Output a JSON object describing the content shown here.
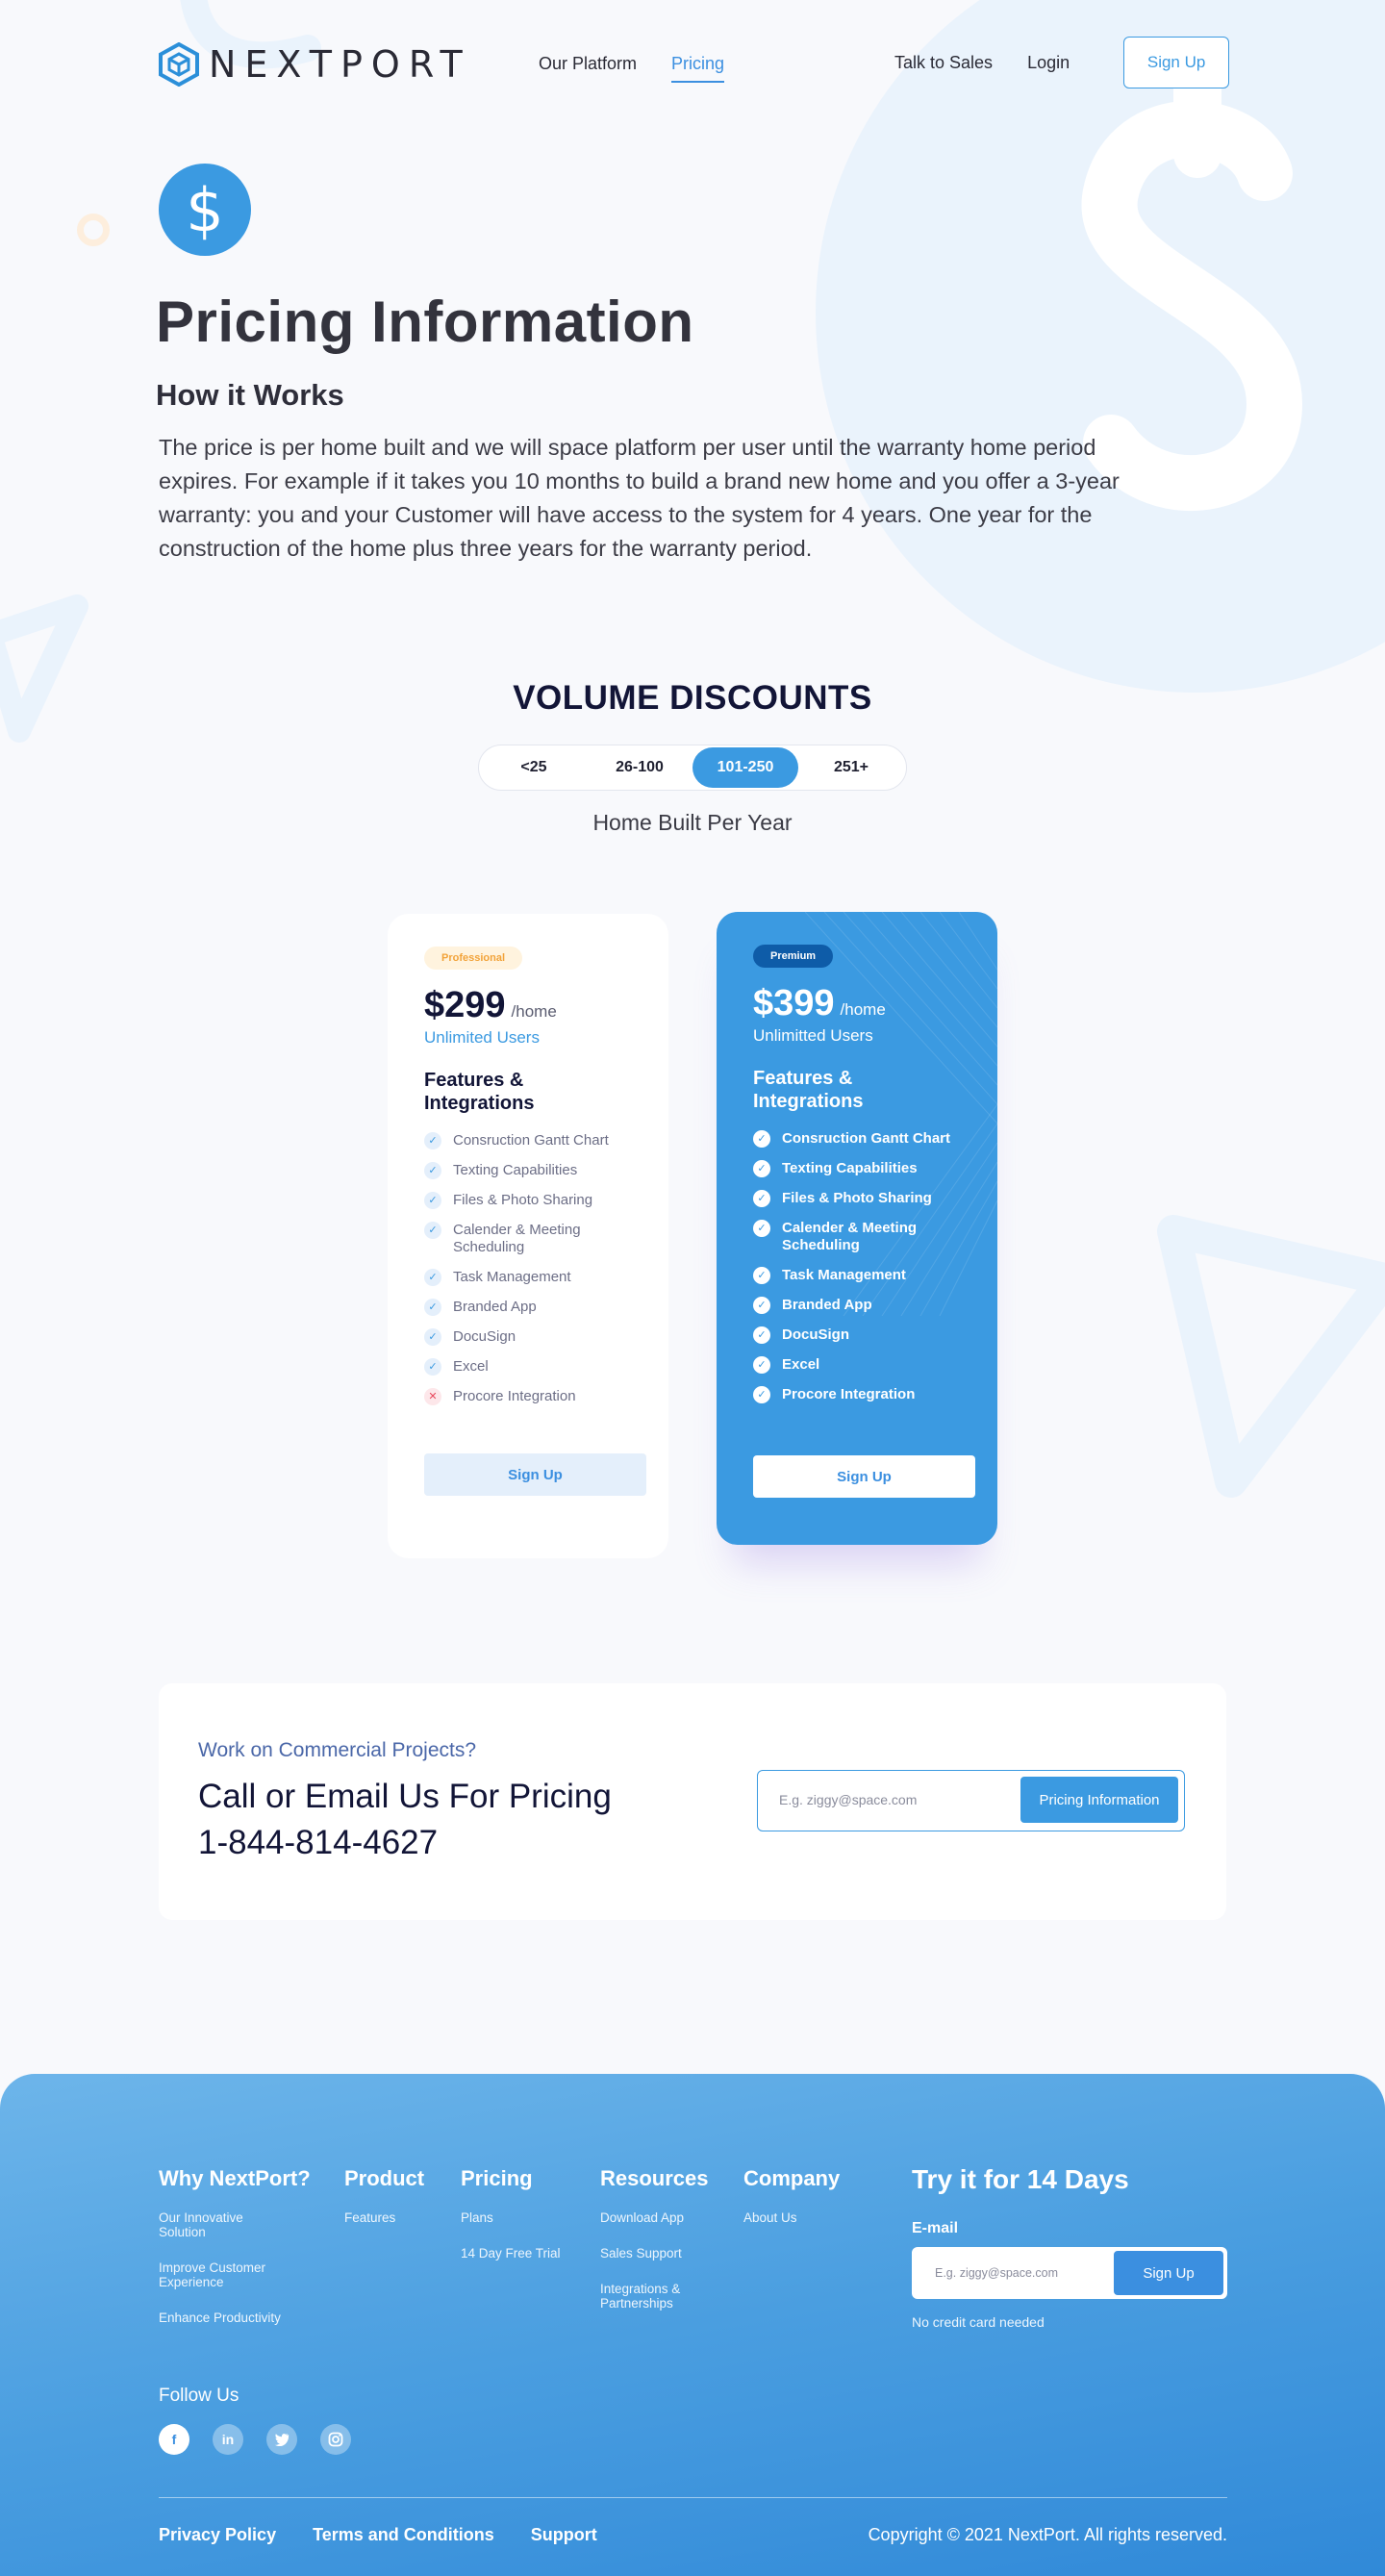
{
  "brand": {
    "name": "NEXTPORT",
    "accent": "#3b9ae1",
    "navy": "#121537"
  },
  "nav": {
    "items": [
      {
        "label": "Our Platform"
      },
      {
        "label": "Pricing"
      }
    ],
    "talk_to_sales": "Talk to Sales",
    "login": "Login",
    "signup": "Sign Up"
  },
  "hero": {
    "icon": "dollar-icon",
    "title": "Pricing Information",
    "subtitle": "How it Works",
    "body": "The price is per home built and we will space  platform per user until the warranty home period expires. For example if it takes you 10 months to build a brand new home and you offer a 3-year warranty:  you and your Customer will have access to the system  for 4 years. One year for the construction of the home plus three years for the warranty period."
  },
  "volume": {
    "title": "VOLUME DISCOUNTS",
    "tabs": [
      "<25",
      "26-100",
      "101-250",
      "251+"
    ],
    "selected": "101-250",
    "caption": "Home Built Per Year"
  },
  "plans": [
    {
      "badge": "Professional",
      "price": "$299",
      "unit": "/home",
      "users": "Unlimited Users",
      "features_title": "Features & Integrations",
      "features": [
        {
          "label": "Consruction Gantt Chart",
          "included": true
        },
        {
          "label": "Texting Capabilities",
          "included": true
        },
        {
          "label": "Files & Photo Sharing",
          "included": true
        },
        {
          "label": "Calender & Meeting Scheduling",
          "included": true
        },
        {
          "label": "Task Management",
          "included": true
        },
        {
          "label": "Branded App",
          "included": true
        },
        {
          "label": "DocuSign",
          "included": true
        },
        {
          "label": "Excel",
          "included": true
        },
        {
          "label": "Procore Integration",
          "included": false
        }
      ],
      "cta": "Sign Up"
    },
    {
      "badge": "Premium",
      "price": "$399",
      "unit": "/home",
      "users": "Unlimitted Users",
      "features_title": "Features & Integrations",
      "features": [
        {
          "label": "Consruction Gantt Chart",
          "included": true
        },
        {
          "label": "Texting Capabilities",
          "included": true
        },
        {
          "label": "Files & Photo Sharing",
          "included": true
        },
        {
          "label": "Calender & Meeting Scheduling",
          "included": true
        },
        {
          "label": "Task Management",
          "included": true
        },
        {
          "label": "Branded App",
          "included": true
        },
        {
          "label": "DocuSign",
          "included": true
        },
        {
          "label": "Excel",
          "included": true
        },
        {
          "label": "Procore Integration",
          "included": true
        }
      ],
      "cta": "Sign Up"
    }
  ],
  "contact": {
    "kicker": "Work on Commercial Projects?",
    "headline": "Call or Email Us For Pricing",
    "phone": "1-844-814-4627",
    "email_placeholder": "E.g. ziggy@space.com",
    "button": "Pricing Information"
  },
  "footer": {
    "columns": [
      {
        "title": "Why NextPort?",
        "links": [
          "Our Innovative Solution",
          "Improve Customer Experience",
          "Enhance Productivity"
        ]
      },
      {
        "title": "Product",
        "links": [
          "Features"
        ]
      },
      {
        "title": "Pricing",
        "links": [
          "Plans",
          "14 Day Free Trial"
        ]
      },
      {
        "title": "Resources",
        "links": [
          "Download App",
          "Sales Support",
          "Integrations & Partnerships"
        ]
      },
      {
        "title": "Company",
        "links": [
          "About Us"
        ]
      }
    ],
    "trial": {
      "title": "Try it for 14 Days",
      "email_label": "E-mail",
      "email_placeholder": "E.g. ziggy@space.com",
      "button": "Sign Up",
      "note": "No credit card needed"
    },
    "follow_label": "Follow Us",
    "socials": [
      "facebook-icon",
      "linkedin-icon",
      "twitter-icon",
      "instagram-icon"
    ],
    "bottom_links": [
      "Privacy Policy",
      "Terms and Conditions",
      "Support"
    ],
    "copyright": "Copyright © 2021 NextPort. All rights reserved."
  }
}
